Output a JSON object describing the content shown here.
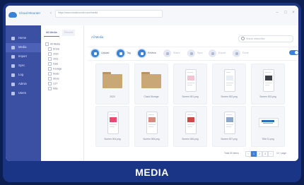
{
  "app": {
    "title": "Cloud Mounter",
    "url": "https://www.cloudmounter.com/media"
  },
  "tile": {
    "label": "MEDIA",
    "bg_color": "#1a3585"
  },
  "sidebar": {
    "items": [
      {
        "label": "Home",
        "icon": "home-icon",
        "active": false
      },
      {
        "label": "Media",
        "icon": "media-icon",
        "active": true
      },
      {
        "label": "Import",
        "icon": "import-icon",
        "active": false
      },
      {
        "label": "Sync",
        "icon": "sync-icon",
        "active": false
      },
      {
        "label": "Log",
        "icon": "log-icon",
        "active": false
      },
      {
        "label": "Admin",
        "icon": "admin-icon",
        "active": false
      },
      {
        "label": "Users",
        "icon": "users-icon",
        "active": false
      }
    ]
  },
  "tree": {
    "tabs": [
      {
        "label": "All Media"
      },
      {
        "label": "Recent"
      }
    ],
    "nodes": [
      {
        "label": "All Media"
      },
      {
        "label": "Drone"
      },
      {
        "label": "2020"
      },
      {
        "label": "2021"
      },
      {
        "label": "Data"
      },
      {
        "label": "Footage"
      },
      {
        "label": "Music"
      },
      {
        "label": "Shots"
      },
      {
        "label": "LUT"
      },
      {
        "label": "Misc"
      }
    ]
  },
  "main": {
    "breadcrumb": "All Media",
    "search": {
      "placeholder": "Search media files"
    },
    "steps": [
      {
        "label": "Upload",
        "active": true
      },
      {
        "label": "Tag",
        "active": true
      },
      {
        "label": "Review",
        "active": true
      },
      {
        "label": "Share",
        "active": false
      },
      {
        "label": "Sync",
        "active": false
      },
      {
        "label": "Export",
        "active": false
      },
      {
        "label": "Done",
        "active": false
      }
    ],
    "files": [
      {
        "name": "2020",
        "kind": "folder"
      },
      {
        "name": "Cloud Storage",
        "kind": "folder"
      },
      {
        "name": "Screen 001.png",
        "kind": "image"
      },
      {
        "name": "Screen 002.png",
        "kind": "image"
      },
      {
        "name": "Screen 003.png",
        "kind": "image"
      },
      {
        "name": "Screen 004.png",
        "kind": "image"
      },
      {
        "name": "Screen 005.png",
        "kind": "image"
      },
      {
        "name": "Screen 006.png",
        "kind": "image"
      },
      {
        "name": "Screen 007.png",
        "kind": "image"
      },
      {
        "name": "Title 01.png",
        "kind": "logo"
      }
    ],
    "pagination": {
      "label": "Total 50 items",
      "pages": [
        "1",
        "2",
        "3"
      ],
      "current": "1",
      "per_page": "10 / page"
    }
  }
}
